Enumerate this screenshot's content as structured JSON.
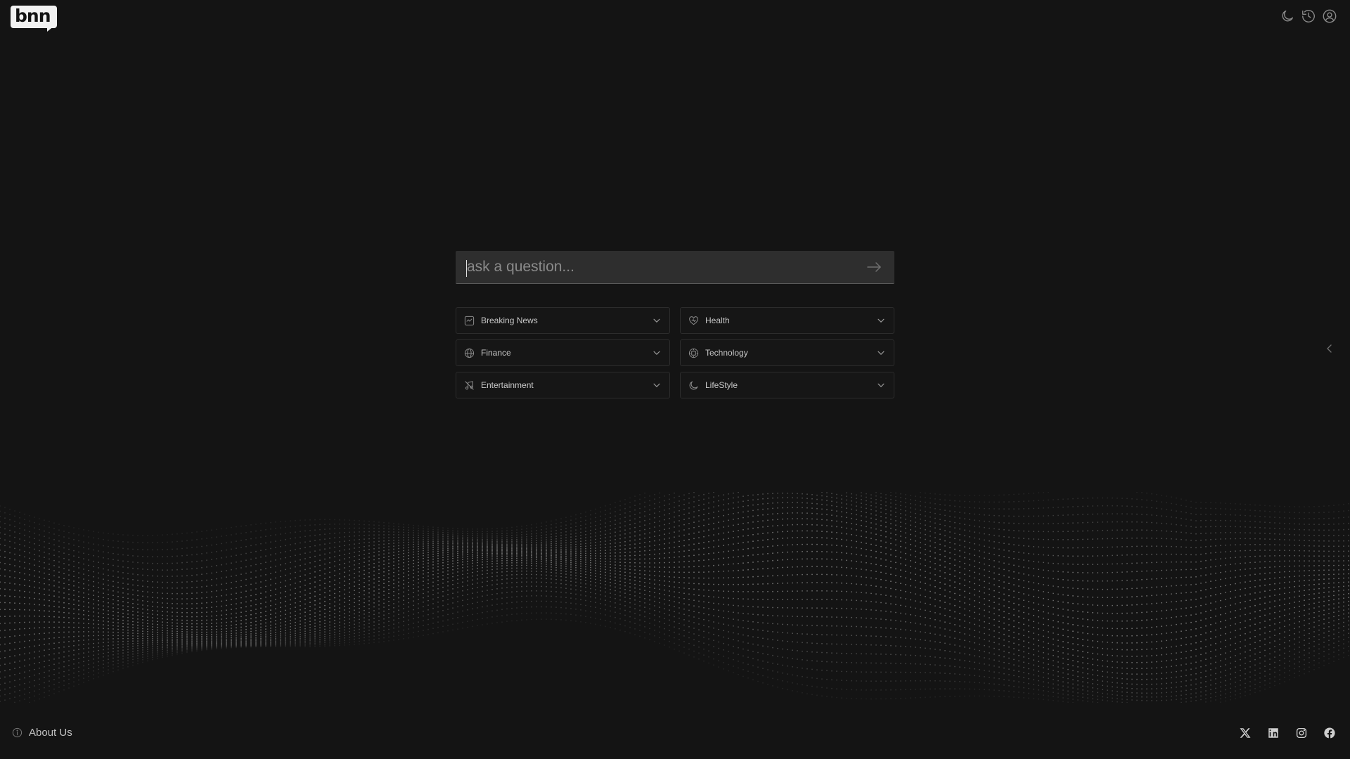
{
  "header": {
    "logo_text": "bnn",
    "icons": [
      "moon-icon",
      "history-icon",
      "user-icon"
    ]
  },
  "search": {
    "placeholder": "ask a question...",
    "value": "",
    "submit_icon": "arrow-right-icon"
  },
  "categories": [
    {
      "label": "Breaking News",
      "icon": "news-icon"
    },
    {
      "label": "Health",
      "icon": "heart-icon"
    },
    {
      "label": "Finance",
      "icon": "globe-icon"
    },
    {
      "label": "Technology",
      "icon": "chip-icon"
    },
    {
      "label": "Entertainment",
      "icon": "music-icon"
    },
    {
      "label": "LifeStyle",
      "icon": "moon-icon"
    }
  ],
  "footer": {
    "about_label": "About Us",
    "socials": [
      "x-icon",
      "linkedin-icon",
      "instagram-icon",
      "facebook-icon"
    ]
  },
  "colors": {
    "background": "#141414",
    "search_bg": "#2e2e2e",
    "text": "#c8c8c8"
  }
}
